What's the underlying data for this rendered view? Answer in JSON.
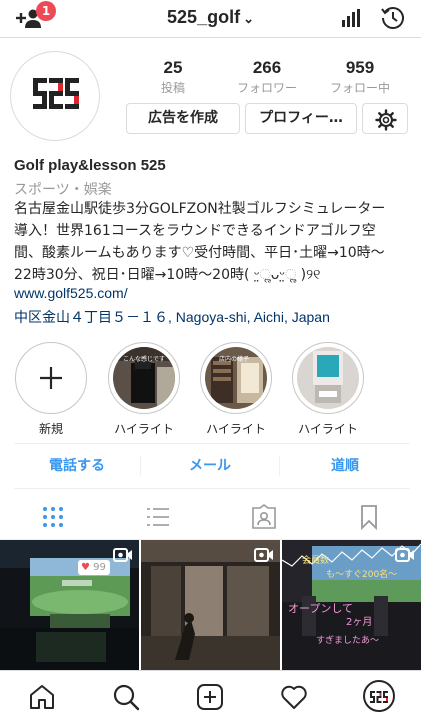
{
  "header": {
    "username": "525_golf",
    "notification_count": "1"
  },
  "profile": {
    "logo_text": "525",
    "stats": [
      {
        "value": "25",
        "label": "投稿"
      },
      {
        "value": "266",
        "label": "フォロワー"
      },
      {
        "value": "959",
        "label": "フォロー中"
      }
    ],
    "promote_label": "広告を作成",
    "edit_label": "プロフィー…"
  },
  "bio": {
    "name": "Golf play&lesson 525",
    "category": "スポーツ・娯楽",
    "lines": [
      "名古屋金山駅徒歩3分GOLFZON社製ゴルフシミュレーター",
      "導入！世界161コースをラウンドできるインドアゴルフ空",
      "間、酸素ルームもあります♡受付時間、平日･土曜→10時〜",
      "22時30分、祝日･日曜→10時〜20時( ᵕ̤ૢᴗᵕ̤ૢ )୨୧"
    ],
    "website": "www.golf525.com/",
    "address": "中区金山４丁目５－１６, Nagoya-shi, Aichi, Japan"
  },
  "highlights": [
    {
      "label": "新規",
      "caption": ""
    },
    {
      "label": "ハイライト",
      "caption": "こんな感じです"
    },
    {
      "label": "ハイライト",
      "caption": "店内の様子"
    },
    {
      "label": "ハイライト",
      "caption": ""
    }
  ],
  "contact": {
    "call": "電話する",
    "email": "メール",
    "directions": "道順"
  },
  "posts": [
    {
      "likes": "99",
      "overlay": ""
    },
    {
      "likes": "",
      "overlay": ""
    },
    {
      "likes": "",
      "overlay": "会員数 も〜すぐ200名〜 オープンして 2ヶ月 すぎましたあ〜"
    }
  ],
  "post_overlay_lines": [
    "会員数",
    "も〜すぐ200名〜",
    "オープンして",
    "2ヶ月",
    "すぎましたあ〜"
  ],
  "colors": {
    "accent": "#3897f0",
    "badge": "#ed4956",
    "link": "#003569",
    "logo_red": "#e0262d"
  }
}
